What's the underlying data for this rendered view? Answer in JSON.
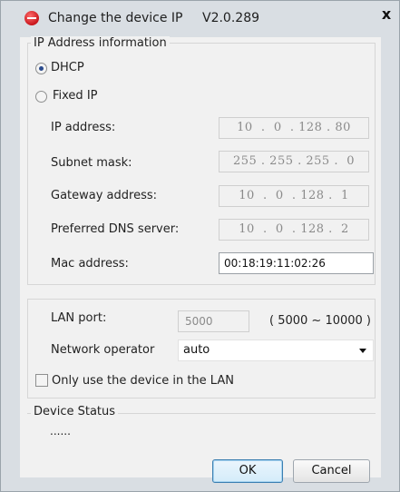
{
  "window": {
    "title": "Change the device IP",
    "version": "V2.0.289",
    "close_label": "x"
  },
  "ip_group": {
    "label": "IP Address information",
    "dhcp_label": "DHCP",
    "fixed_label": "Fixed IP",
    "selected_mode": "DHCP",
    "fields": {
      "ip_address": {
        "label": "IP address:",
        "value": "10  .  0  . 128 . 80"
      },
      "subnet_mask": {
        "label": "Subnet mask:",
        "value": "255 . 255 . 255 .  0"
      },
      "gateway": {
        "label": "Gateway address:",
        "value": "10  .  0  . 128 .  1"
      },
      "dns": {
        "label": "Preferred DNS server:",
        "value": "10  .  0  . 128 .  2"
      },
      "mac": {
        "label": "Mac address:",
        "value": "00:18:19:11:02:26"
      }
    }
  },
  "lan_group": {
    "port_label": "LAN port:",
    "port_value": "5000",
    "port_range": "( 5000 ~ 10000 )",
    "operator_label": "Network operator",
    "operator_value": "auto",
    "lan_only_label": "Only use the device in the LAN",
    "lan_only_checked": false
  },
  "status_group": {
    "label": "Device Status",
    "status_text": "......"
  },
  "buttons": {
    "ok": "OK",
    "cancel": "Cancel"
  },
  "colors": {
    "titlebar": "#d9dee3",
    "client_background": "#f1f1f1",
    "app_icon": "#c8151b",
    "default_button_border": "#3c7fb1"
  }
}
